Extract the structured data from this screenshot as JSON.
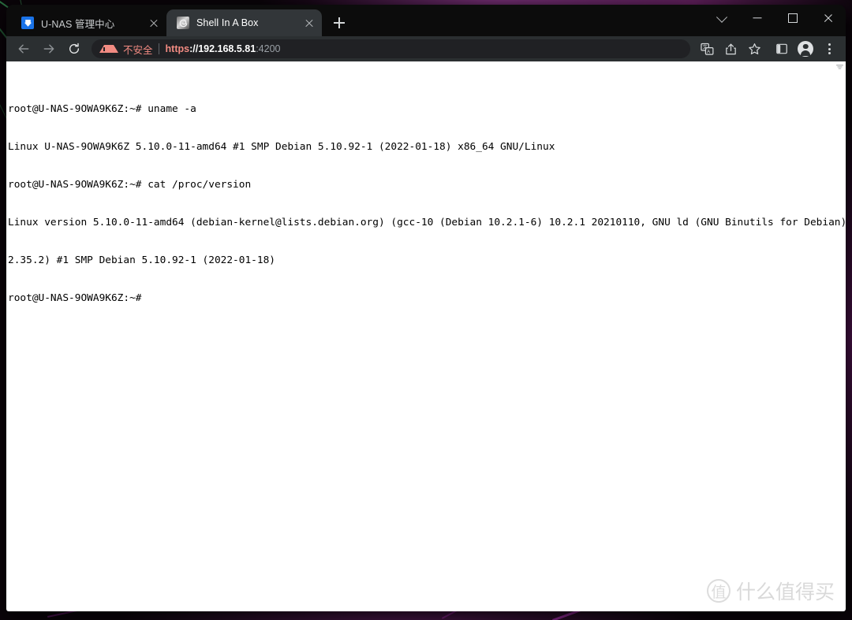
{
  "window": {
    "controls": [
      {
        "name": "tab-search",
        "glyph": "chevron-down"
      },
      {
        "name": "minimize",
        "glyph": "minus"
      },
      {
        "name": "maximize",
        "glyph": "square"
      },
      {
        "name": "close",
        "glyph": "x"
      }
    ]
  },
  "tabs": [
    {
      "title": "U-NAS 管理中心",
      "favicon": "unas-icon",
      "active": false
    },
    {
      "title": "Shell In A Box",
      "favicon": "shell-icon",
      "active": true
    }
  ],
  "newtab": {
    "label": "+"
  },
  "toolbar": {
    "back": "←",
    "forward": "→",
    "reload": "⟳",
    "icons": [
      {
        "name": "translate-icon",
        "label": "翻译"
      },
      {
        "name": "share-icon",
        "label": "分享"
      },
      {
        "name": "bookmark-star-icon",
        "label": "收藏"
      },
      {
        "name": "side-panel-icon",
        "label": "侧边栏"
      },
      {
        "name": "profile-avatar",
        "label": "个人资料"
      },
      {
        "name": "more-menu-icon",
        "label": "自定义及控制"
      }
    ]
  },
  "omnibox": {
    "security_label": "不安全",
    "scheme": "https",
    "separator": "://",
    "host": "192.168.5.81",
    "rest": ":4200",
    "full_url": "https://192.168.5.81:4200"
  },
  "terminal": {
    "lines": [
      "root@U-NAS-9OWA9K6Z:~# uname -a",
      "Linux U-NAS-9OWA9K6Z 5.10.0-11-amd64 #1 SMP Debian 5.10.92-1 (2022-01-18) x86_64 GNU/Linux",
      "root@U-NAS-9OWA9K6Z:~# cat /proc/version",
      "Linux version 5.10.0-11-amd64 (debian-kernel@lists.debian.org) (gcc-10 (Debian 10.2.1-6) 10.2.1 20210110, GNU ld (GNU Binutils for Debian)",
      "2.35.2) #1 SMP Debian 5.10.92-1 (2022-01-18)",
      "root@U-NAS-9OWA9K6Z:~#"
    ],
    "prompt": "root@U-NAS-9OWA9K6Z:~#",
    "hostname": "U-NAS-9OWA9K6Z",
    "commands": [
      "uname -a",
      "cat /proc/version"
    ],
    "kernel": "5.10.0-11-amd64",
    "distro": "Debian 5.10.92-1 (2022-01-18)",
    "arch": "x86_64 GNU/Linux"
  },
  "watermark": {
    "badge": "值",
    "text": "什么值得买"
  },
  "colors": {
    "tabstrip": "#0c0c0c",
    "toolbar": "#2b2f31",
    "active_tab": "#323639",
    "omnibox": "#202124",
    "warning": "#f28b82",
    "page_bg": "#ffffff",
    "terminal_text": "#000000",
    "favicon_unas": "#1a73e8"
  }
}
